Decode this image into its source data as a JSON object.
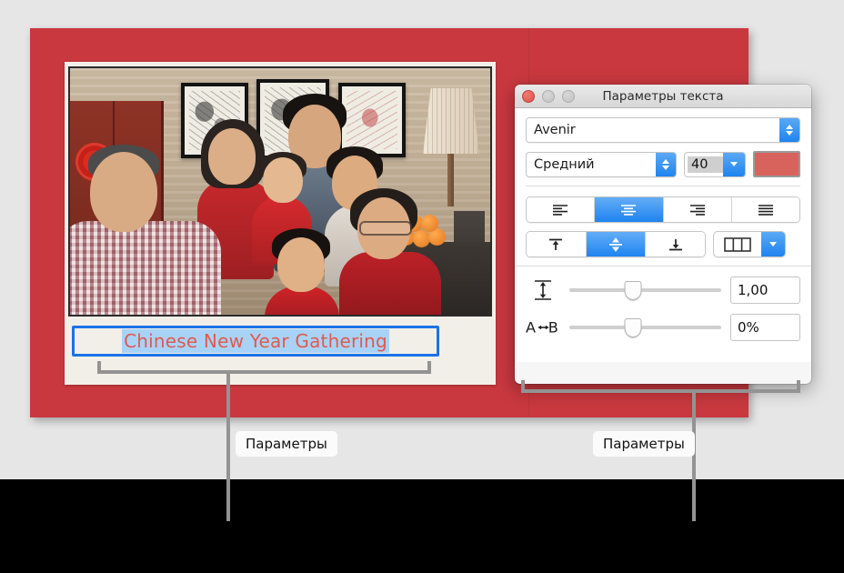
{
  "window": {
    "title": "Параметры текста",
    "controls": {
      "close": "close-button",
      "minimize": "minimize-button",
      "maximize": "maximize-button"
    },
    "font": {
      "family_value": "Avenir",
      "typeface_value": "Средний",
      "size_value": "40",
      "color_hex": "#d8625c"
    },
    "paragraph_alignment": {
      "options": [
        "align-left",
        "align-center",
        "align-right",
        "align-justify"
      ],
      "selected_index": 1
    },
    "vertical_alignment": {
      "options": [
        "valign-top",
        "valign-middle",
        "valign-bottom"
      ],
      "selected_index": 1
    },
    "columns": {
      "icon": "columns-icon",
      "dropdown": "chevron-down-icon"
    },
    "spacing": {
      "line_icon": "line-spacing-icon",
      "line_value": "1,00",
      "line_slider_percent": 42,
      "char_icon": "A↔B",
      "char_value": "0%",
      "char_slider_percent": 42
    }
  },
  "slide": {
    "background_hex": "#c9383f",
    "caption_text": "Chinese New Year Gathering",
    "caption_text_color": "#e05a4e",
    "caption_selection_hex": "#a9d2f7",
    "caption_border_hex": "#1b72e8",
    "photo_alt": "family-photo"
  },
  "callouts": [
    {
      "label": "Параметры",
      "target": "text-caption-field"
    },
    {
      "label": "Параметры",
      "target": "text-options-window"
    }
  ]
}
